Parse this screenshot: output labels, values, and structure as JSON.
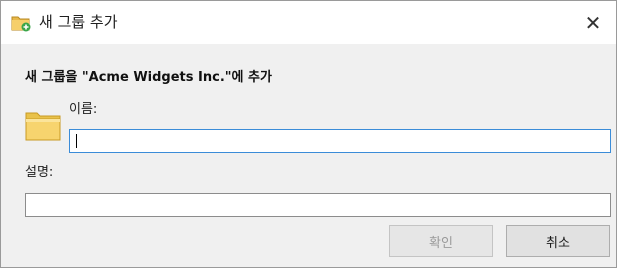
{
  "window": {
    "title": "새 그룹 추가",
    "title_icon": "folder-add-icon",
    "close_glyph": "✕"
  },
  "form": {
    "heading": "새 그룹을 \"Acme Widgets Inc.\"에 추가",
    "name_label": "이름:",
    "name_value": "",
    "description_label": "설명:",
    "description_value": "",
    "folder_icon": "folder-icon"
  },
  "buttons": {
    "ok_label": "확인",
    "ok_enabled": false,
    "cancel_label": "취소"
  }
}
